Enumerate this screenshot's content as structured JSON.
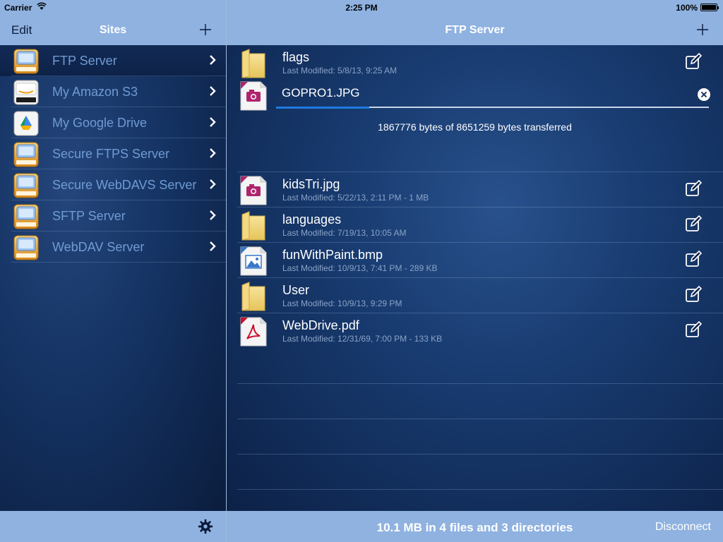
{
  "status_bar": {
    "carrier": "Carrier",
    "time": "2:25 PM",
    "battery": "100%"
  },
  "sites_nav": {
    "edit_label": "Edit",
    "title": "Sites",
    "add_icon": "plus-icon"
  },
  "sites": [
    {
      "label": "FTP Server",
      "icon": "ftp-drive-icon",
      "selected": true
    },
    {
      "label": "My Amazon S3",
      "icon": "amazon-drive-icon"
    },
    {
      "label": "My Google Drive",
      "icon": "google-drive-icon"
    },
    {
      "label": "Secure FTPS Server",
      "icon": "ftps-drive-icon"
    },
    {
      "label": "Secure WebDAVS Server",
      "icon": "webdavs-drive-icon"
    },
    {
      "label": "SFTP Server",
      "icon": "sftp-drive-icon"
    },
    {
      "label": "WebDAV Server",
      "icon": "webdav-drive-icon"
    }
  ],
  "browser_nav": {
    "title": "FTP Server",
    "add_icon": "plus-icon"
  },
  "files": [
    {
      "name": "flags",
      "meta": "Last Modified: 5/8/13, 9:25 AM",
      "type": "folder"
    },
    {
      "name": "kidsTri.jpg",
      "meta": "Last Modified: 5/22/13, 2:11 PM - 1 MB",
      "type": "photo"
    },
    {
      "name": "languages",
      "meta": "Last Modified: 7/19/13, 10:05 AM",
      "type": "folder"
    },
    {
      "name": "funWithPaint.bmp",
      "meta": "Last Modified: 10/9/13, 7:41 PM - 289 KB",
      "type": "image"
    },
    {
      "name": "User",
      "meta": "Last Modified: 10/9/13, 9:29 PM",
      "type": "folder"
    },
    {
      "name": "WebDrive.pdf",
      "meta": "Last Modified: 12/31/69, 7:00 PM - 133 KB",
      "type": "pdf"
    }
  ],
  "transfer": {
    "file_name": "GOPRO1.JPG",
    "status": "1867776 bytes of 8651259 bytes transferred",
    "progress": 0.216
  },
  "bottom_bar": {
    "summary": "10.1 MB in 4 files and 3 directories",
    "disconnect_label": "Disconnect",
    "settings_icon": "gear-icon"
  },
  "colors": {
    "bar": "#8fb2e0",
    "site_label": "#6f9bd3",
    "progress": "#1e7ae0"
  }
}
